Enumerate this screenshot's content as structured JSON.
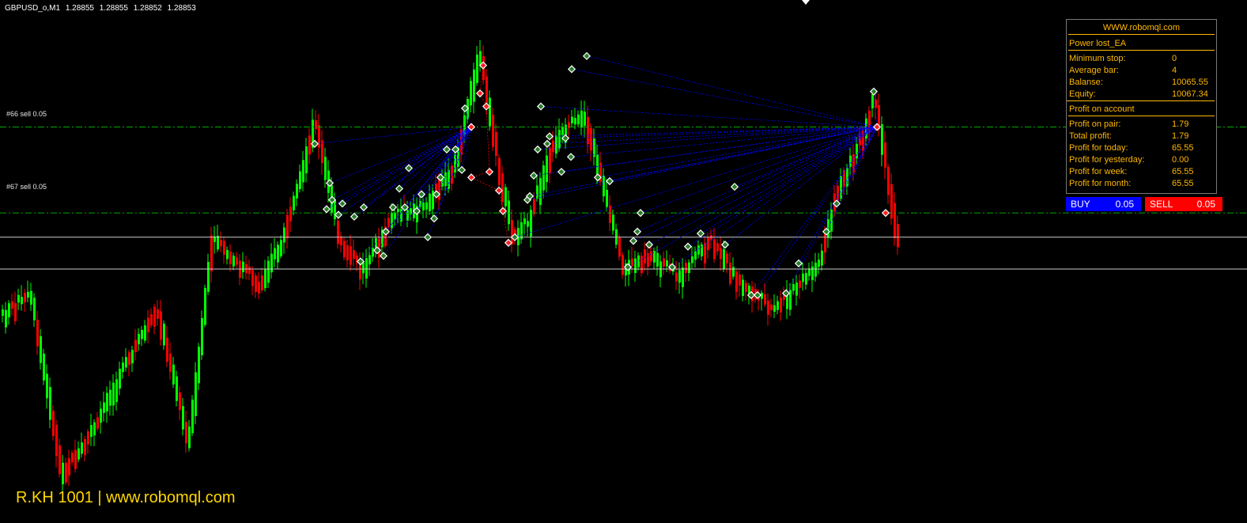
{
  "window": {
    "symbol": "GBPUSD_o,M1",
    "open": "1.28855",
    "high": "1.28855",
    "low": "1.28852",
    "close": "1.28853"
  },
  "orders": [
    {
      "label": "#66 sell 0.05",
      "price": 1.28912
    },
    {
      "label": "#67 sell 0.05",
      "price": 1.28866
    }
  ],
  "levels": {
    "bid": 1.28853,
    "ask": 1.28836
  },
  "watermark": "R.KH 1001 | www.robomql.com",
  "panel": {
    "site": "WWW.robomql.com",
    "ea_name": "Power lost_EA",
    "stats": [
      {
        "label": "Minimum stop:",
        "value": "0"
      },
      {
        "label": "Average bar:",
        "value": "4"
      },
      {
        "label": "Balanse:",
        "value": "10065.55"
      },
      {
        "label": "Equity:",
        "value": "10067.34"
      }
    ],
    "profit_header": "Profit on account",
    "profits": [
      {
        "label": "Profit on pair:",
        "value": "1.79"
      },
      {
        "label": "Total profit:",
        "value": "1.79"
      },
      {
        "label": "Profit for today:",
        "value": "65.55"
      },
      {
        "label": "Profit for yesterday:",
        "value": "0.00"
      },
      {
        "label": "Profit for week:",
        "value": "65.55"
      },
      {
        "label": "Profit for month:",
        "value": "65.55"
      }
    ]
  },
  "buttons": {
    "buy_label": "BUY",
    "buy_lot": "0.05",
    "sell_label": "SELL",
    "sell_lot": "0.05"
  },
  "colors": {
    "bull": "#00ff00",
    "bear": "#ff0000",
    "order_line": "#00aa00",
    "trend_line": "#0000ff",
    "panel_text": "#ffb800",
    "buy": "#0000ff",
    "sell": "#ff0000"
  },
  "chart_data": {
    "type": "candlestick",
    "y_range": [
      1.287,
      1.2898
    ],
    "hubs": [
      {
        "x": 596,
        "price": 1.28912
      },
      {
        "x": 1109,
        "price": 1.28912
      }
    ],
    "blue_markers": [
      {
        "x": 398,
        "price": 1.28903
      },
      {
        "x": 417,
        "price": 1.28882
      },
      {
        "x": 420,
        "price": 1.28873
      },
      {
        "x": 413,
        "price": 1.28868
      },
      {
        "x": 428,
        "price": 1.28865
      },
      {
        "x": 433,
        "price": 1.28871
      },
      {
        "x": 448,
        "price": 1.28864
      },
      {
        "x": 460,
        "price": 1.28869
      },
      {
        "x": 456,
        "price": 1.2884
      },
      {
        "x": 477,
        "price": 1.28846
      },
      {
        "x": 485,
        "price": 1.28843
      },
      {
        "x": 488,
        "price": 1.28856
      },
      {
        "x": 497,
        "price": 1.28869
      },
      {
        "x": 505,
        "price": 1.28879
      },
      {
        "x": 512,
        "price": 1.28869
      },
      {
        "x": 517,
        "price": 1.2889
      },
      {
        "x": 527,
        "price": 1.28867
      },
      {
        "x": 533,
        "price": 1.28876
      },
      {
        "x": 541,
        "price": 1.28853
      },
      {
        "x": 549,
        "price": 1.28863
      },
      {
        "x": 552,
        "price": 1.28876
      },
      {
        "x": 557,
        "price": 1.28885
      },
      {
        "x": 565,
        "price": 1.289
      },
      {
        "x": 576,
        "price": 1.289
      },
      {
        "x": 584,
        "price": 1.28889
      },
      {
        "x": 588,
        "price": 1.28922
      },
      {
        "x": 651,
        "price": 1.28853
      },
      {
        "x": 667,
        "price": 1.28873
      },
      {
        "x": 670,
        "price": 1.28875
      },
      {
        "x": 675,
        "price": 1.28886
      },
      {
        "x": 680,
        "price": 1.289
      },
      {
        "x": 684,
        "price": 1.28923
      },
      {
        "x": 692,
        "price": 1.28903
      },
      {
        "x": 695,
        "price": 1.28907
      },
      {
        "x": 710,
        "price": 1.28888
      },
      {
        "x": 715,
        "price": 1.28906
      },
      {
        "x": 722,
        "price": 1.28896
      },
      {
        "x": 723,
        "price": 1.28943
      },
      {
        "x": 742,
        "price": 1.2895
      },
      {
        "x": 756,
        "price": 1.28885
      },
      {
        "x": 771,
        "price": 1.28883
      },
      {
        "x": 810,
        "price": 1.28866
      },
      {
        "x": 806,
        "price": 1.28856
      },
      {
        "x": 801,
        "price": 1.28851
      },
      {
        "x": 821,
        "price": 1.28849
      },
      {
        "x": 794,
        "price": 1.28837
      },
      {
        "x": 850,
        "price": 1.28837
      },
      {
        "x": 870,
        "price": 1.28848
      },
      {
        "x": 886,
        "price": 1.28855
      },
      {
        "x": 917,
        "price": 1.28849
      },
      {
        "x": 929,
        "price": 1.2888
      },
      {
        "x": 950,
        "price": 1.28822
      },
      {
        "x": 958,
        "price": 1.28822
      },
      {
        "x": 994,
        "price": 1.28823
      },
      {
        "x": 1010,
        "price": 1.28839
      },
      {
        "x": 1045,
        "price": 1.28856
      },
      {
        "x": 1058,
        "price": 1.28871
      },
      {
        "x": 1105,
        "price": 1.28931
      }
    ],
    "red_markers": [
      {
        "x": 611,
        "price": 1.28945
      },
      {
        "x": 607,
        "price": 1.2893
      },
      {
        "x": 615,
        "price": 1.28923
      },
      {
        "x": 619,
        "price": 1.28888
      },
      {
        "x": 596,
        "price": 1.28885
      },
      {
        "x": 631,
        "price": 1.28878
      },
      {
        "x": 636,
        "price": 1.28867
      },
      {
        "x": 643,
        "price": 1.2885
      },
      {
        "x": 1120,
        "price": 1.28866
      }
    ]
  }
}
